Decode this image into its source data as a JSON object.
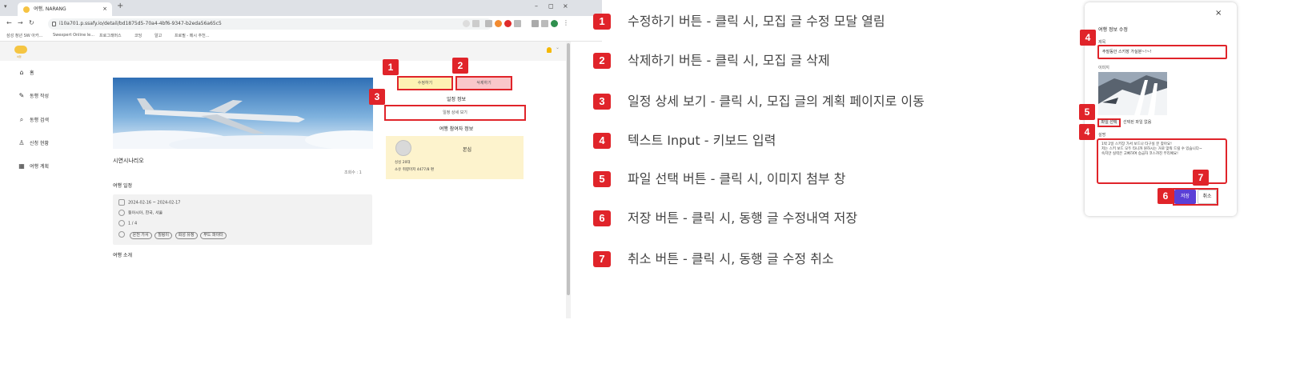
{
  "browser": {
    "tab_title": "여행, NARANG",
    "url": "i10a701.p.ssafy.io/detail/bd1875d5-70a4-4bf6-9347-b2eda56a65c5",
    "bookmarks": [
      "삼성 청년 SW 아카...",
      "Swexpert Online le...",
      "프로그래머스",
      "코딩",
      "알고",
      "프로필 - 메시 추천..."
    ]
  },
  "app": {
    "logo_text": "여행",
    "sidebar": [
      {
        "icon": "home-icon",
        "glyph": "⌂",
        "label": "홈"
      },
      {
        "icon": "pencil-icon",
        "glyph": "✎",
        "label": "동행 작성"
      },
      {
        "icon": "search-icon",
        "glyph": "⌕",
        "label": "동행 검색"
      },
      {
        "icon": "person-add-icon",
        "glyph": "♙",
        "label": "신청 현황"
      },
      {
        "icon": "calendar-icon",
        "glyph": "▦",
        "label": "여행 계획"
      }
    ],
    "post": {
      "title": "시연시나리오",
      "view_count": "조회수 : 1",
      "schedule_heading": "여행 일정",
      "dates": "2024-02-16 ~ 2024-02-17",
      "location": "동아시아, 한국, 서울",
      "members": "1 / 4",
      "tags": [
        "온천 가서",
        "힐링이",
        "회성 유정",
        "푸드 파이터"
      ],
      "intro_heading": "여행 소개"
    },
    "actions": {
      "edit_label": "수정하기",
      "delete_label": "삭제하기",
      "schedule_info_heading": "일정 정보",
      "plan_button_label": "일정 상세 보기",
      "participants_heading": "여행 참여자 정보"
    },
    "participant": {
      "name": "본심",
      "age_gender": "싱싱 20대",
      "preference": "소유 취향마저 4477/8 편"
    }
  },
  "badges_left": [
    "1",
    "2",
    "3"
  ],
  "legend": [
    {
      "num": "1",
      "text": "수정하기 버튼 - 클릭 시, 모집 글 수정 모달 열림"
    },
    {
      "num": "2",
      "text": "삭제하기 버튼 - 클릭 시, 모집 글 삭제"
    },
    {
      "num": "3",
      "text": "일정 상세 보기 - 클릭 시, 모집 글의 계획 페이지로 이동"
    },
    {
      "num": "4",
      "text": "텍스트 Input - 키보드 입력"
    },
    {
      "num": "5",
      "text": "파일 선택 버튼 - 클릭 시, 이미지 첨부 창"
    },
    {
      "num": "6",
      "text": "저장 버튼 - 클릭 시, 동행 글 수정내역 저장"
    },
    {
      "num": "7",
      "text": "취소 버튼 - 클릭 시, 동행 글 수정 취소"
    }
  ],
  "modal": {
    "title": "여행 정보 수정",
    "close": "×",
    "title_label": "제목",
    "title_value": "주말동안 스키장 가실분~!~!",
    "image_label": "이미지",
    "file_button": "파일 선택",
    "file_none": "선택된 파일 없음",
    "desc_label": "설명",
    "desc_value": "1박 2일 스키장 가서 보드나 타구실 분 찾아요!\n저는 스키 보드 모두 타니까 원하시는 거로 맞춰 드릴 수 있습니다~\n숙지만 실력은 고삐하여 승급자 코스까진 무리예요!",
    "save": "저장",
    "cancel": "취소",
    "badges": {
      "title": "4",
      "file": "5",
      "desc": "4",
      "save": "6",
      "cancel": "7"
    }
  },
  "colors": {
    "annotation_red": "#e0242a",
    "edit_yellow": "#fdf2b3",
    "delete_pink": "#f9c7ca",
    "save_purple": "#5b3fd6",
    "participant_bg": "#fdf3cd"
  }
}
